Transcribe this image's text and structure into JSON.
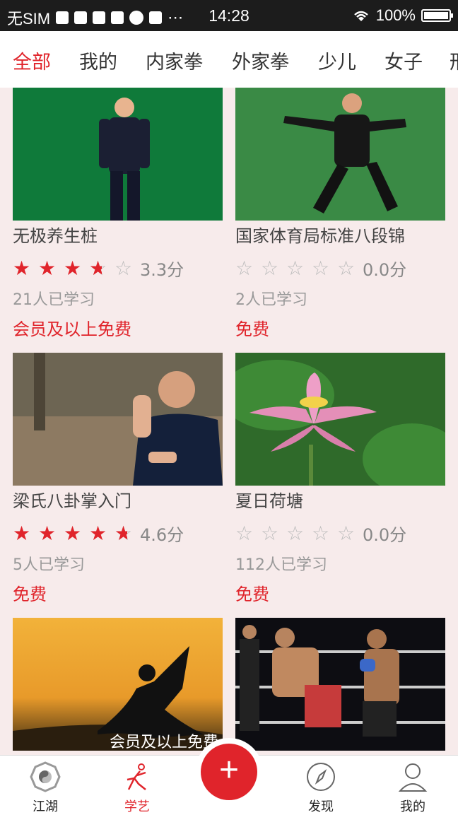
{
  "status_bar": {
    "carrier": "无SIM",
    "time": "14:28",
    "battery": "100%"
  },
  "tabs": [
    "全部",
    "我的",
    "内家拳",
    "外家拳",
    "少儿",
    "女子",
    "形"
  ],
  "active_tab": 0,
  "courses": [
    {
      "title": "无极养生桩",
      "rating": 3.3,
      "score": "3.3分",
      "learners": "21人已学习",
      "price": "会员及以上免费"
    },
    {
      "title": "国家体育局标准八段锦",
      "rating": 0,
      "score": "0.0分",
      "learners": "2人已学习",
      "price": "免费"
    },
    {
      "title": "梁氏八卦掌入门",
      "rating": 4.6,
      "score": "4.6分",
      "learners": "5人已学习",
      "price": "免费"
    },
    {
      "title": "夏日荷塘",
      "rating": 0,
      "score": "0.0分",
      "learners": "112人已学习",
      "price": "免费"
    },
    {
      "badge": "会员及以上免费"
    },
    {}
  ],
  "bottom_nav": {
    "items": [
      "江湖",
      "学艺",
      "",
      "发现",
      "我的"
    ],
    "active": 1,
    "fab_symbol": "+"
  },
  "colors": {
    "accent": "#e0242b",
    "background": "#f7ebeb"
  }
}
